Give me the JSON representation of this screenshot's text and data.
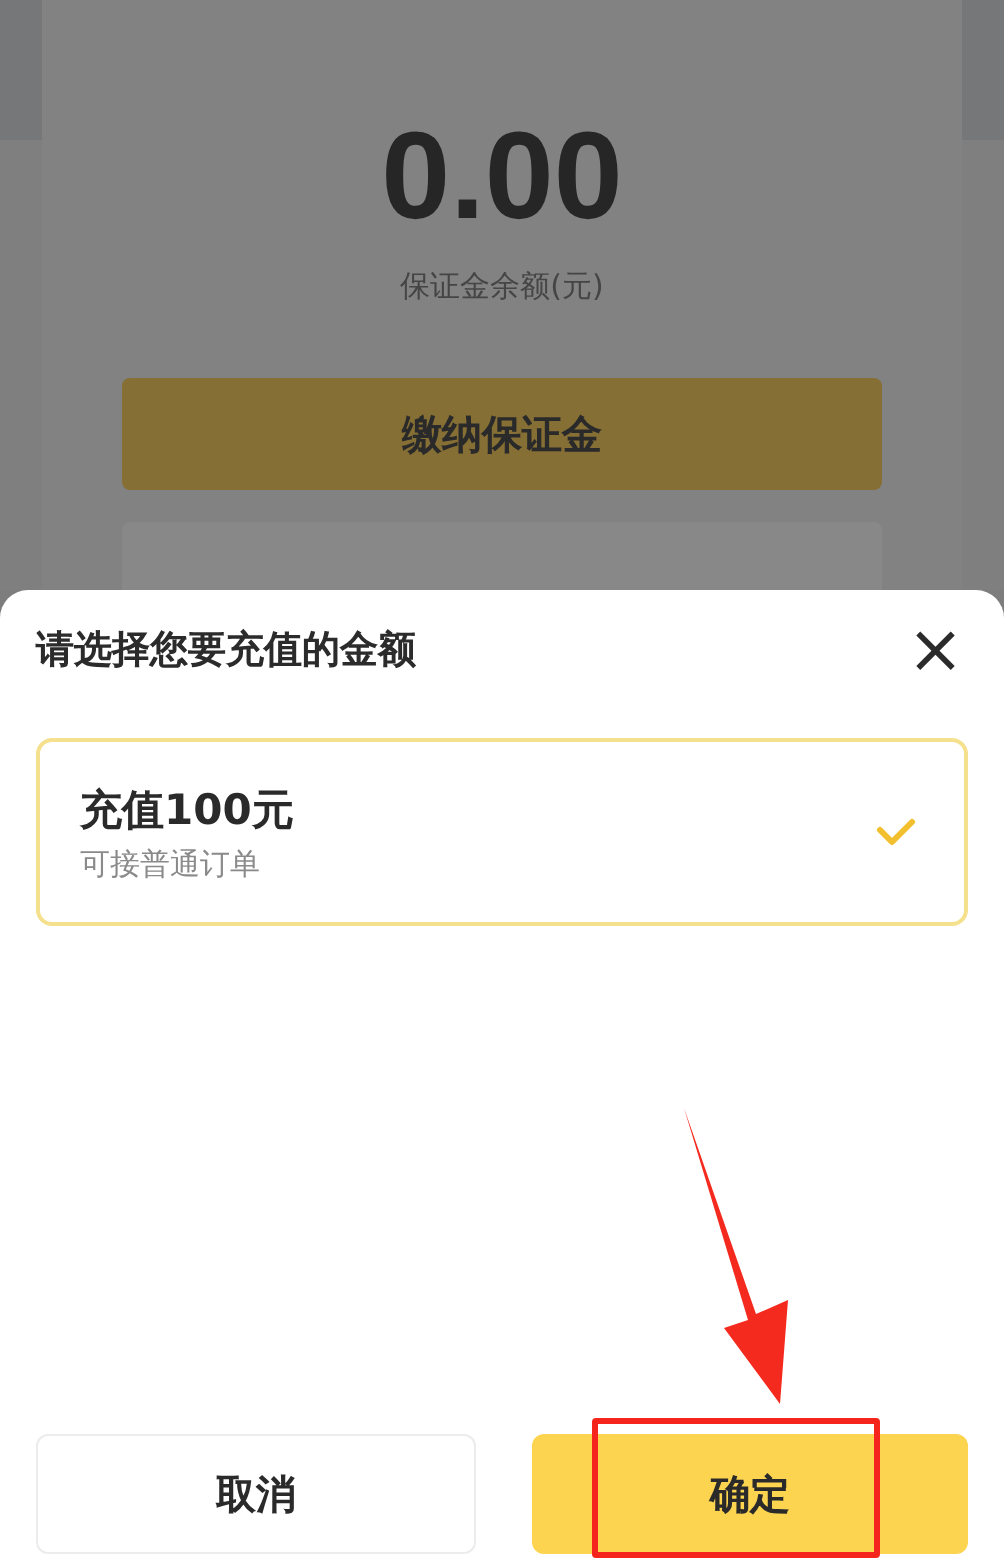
{
  "balance": {
    "amount": "0.00",
    "label": "保证金余额(元)"
  },
  "actions": [
    "缴纳保证金"
  ],
  "sheet": {
    "title": "请选择您要充值的金额",
    "close": "×",
    "options": [
      {
        "title": "充值100元",
        "subtitle": "可接普通订单",
        "selected": true
      }
    ],
    "buttons": [
      {
        "label": "取消",
        "kind": "secondary"
      },
      {
        "label": "确定",
        "kind": "primary"
      }
    ]
  }
}
